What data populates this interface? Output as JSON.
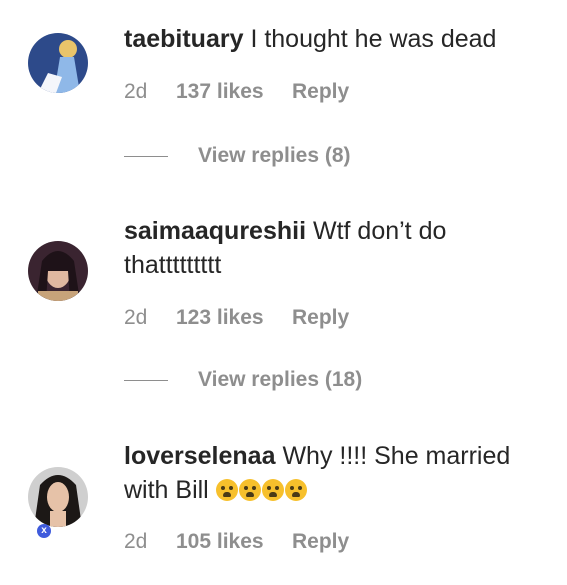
{
  "comments": [
    {
      "username": "taebituary",
      "text": "I thought he was dead",
      "time": "2d",
      "likes": "137 likes",
      "reply": "Reply",
      "view_replies": "View replies (8)"
    },
    {
      "username": "saimaaqureshii",
      "text": "Wtf don’t do thattttttttt",
      "time": "2d",
      "likes": "123 likes",
      "reply": "Reply",
      "view_replies": "View replies (18)"
    },
    {
      "username": "loverselenaa",
      "text": "Why !!!! She married with Bill",
      "time": "2d",
      "likes": "105 likes",
      "reply": "Reply",
      "emojis": [
        "disappointed-face-emoji",
        "fearful-face-emoji",
        "crying-face-emoji",
        "crying-face-emoji"
      ]
    }
  ],
  "badge": {
    "label": "x",
    "color": "#3f5bdc"
  }
}
